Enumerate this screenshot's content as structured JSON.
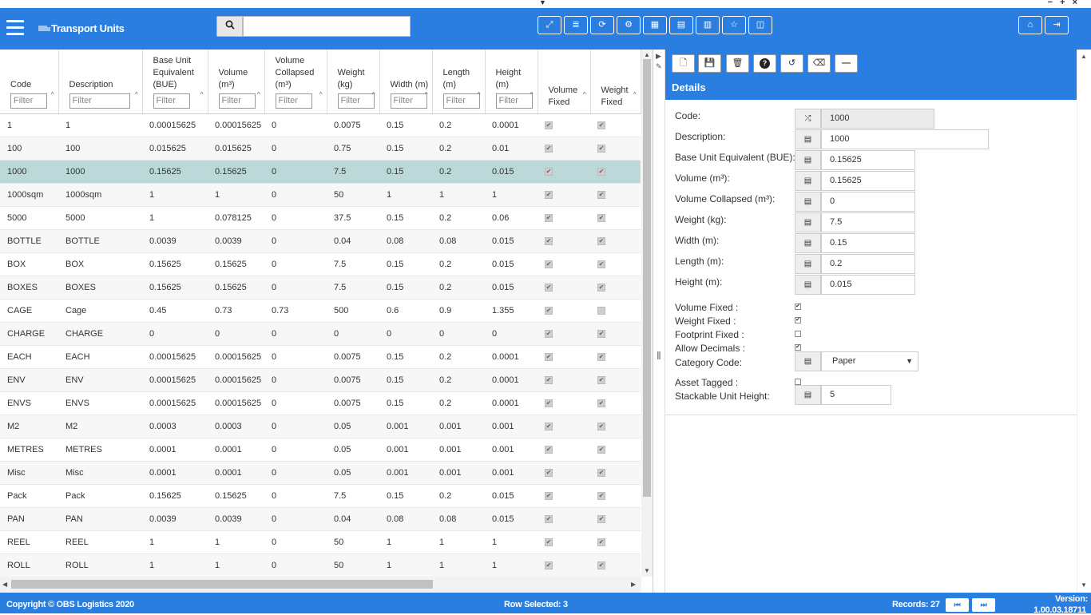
{
  "window": {
    "controls": "− + ×"
  },
  "header": {
    "title": "Transport Units",
    "search_value": ""
  },
  "grid": {
    "columns": [
      {
        "label": "Code",
        "filter": "Filter"
      },
      {
        "label": "Description",
        "filter": "Filter"
      },
      {
        "label": "Base Unit Equivalent (BUE)",
        "filter": "Filter"
      },
      {
        "label": "Volume (m³)",
        "filter": "Filter"
      },
      {
        "label": "Volume Collapsed (m³)",
        "filter": "Filter"
      },
      {
        "label": "Weight (kg)",
        "filter": "Filter"
      },
      {
        "label": "Width (m)",
        "filter": "Filter"
      },
      {
        "label": "Length (m)",
        "filter": "Filter"
      },
      {
        "label": "Height (m)",
        "filter": "Filter"
      },
      {
        "label": "Volume Fixed",
        "filter": ""
      },
      {
        "label": "Weight Fixed",
        "filter": ""
      }
    ],
    "selected_index": 2,
    "rows": [
      [
        "1",
        "1",
        "0.00015625",
        "0.00015625",
        "0",
        "0.0075",
        "0.15",
        "0.2",
        "0.0001",
        true,
        true
      ],
      [
        "100",
        "100",
        "0.015625",
        "0.015625",
        "0",
        "0.75",
        "0.15",
        "0.2",
        "0.01",
        true,
        true
      ],
      [
        "1000",
        "1000",
        "0.15625",
        "0.15625",
        "0",
        "7.5",
        "0.15",
        "0.2",
        "0.015",
        true,
        true
      ],
      [
        "1000sqm",
        "1000sqm",
        "1",
        "1",
        "0",
        "50",
        "1",
        "1",
        "1",
        true,
        true
      ],
      [
        "5000",
        "5000",
        "1",
        "0.078125",
        "0",
        "37.5",
        "0.15",
        "0.2",
        "0.06",
        true,
        true
      ],
      [
        "BOTTLE",
        "BOTTLE",
        "0.0039",
        "0.0039",
        "0",
        "0.04",
        "0.08",
        "0.08",
        "0.015",
        true,
        true
      ],
      [
        "BOX",
        "BOX",
        "0.15625",
        "0.15625",
        "0",
        "7.5",
        "0.15",
        "0.2",
        "0.015",
        true,
        true
      ],
      [
        "BOXES",
        "BOXES",
        "0.15625",
        "0.15625",
        "0",
        "7.5",
        "0.15",
        "0.2",
        "0.015",
        true,
        true
      ],
      [
        "CAGE",
        "Cage",
        "0.45",
        "0.73",
        "0.73",
        "500",
        "0.6",
        "0.9",
        "1.355",
        true,
        false
      ],
      [
        "CHARGE",
        "CHARGE",
        "0",
        "0",
        "0",
        "0",
        "0",
        "0",
        "0",
        true,
        true
      ],
      [
        "EACH",
        "EACH",
        "0.00015625",
        "0.00015625",
        "0",
        "0.0075",
        "0.15",
        "0.2",
        "0.0001",
        true,
        true
      ],
      [
        "ENV",
        "ENV",
        "0.00015625",
        "0.00015625",
        "0",
        "0.0075",
        "0.15",
        "0.2",
        "0.0001",
        true,
        true
      ],
      [
        "ENVS",
        "ENVS",
        "0.00015625",
        "0.00015625",
        "0",
        "0.0075",
        "0.15",
        "0.2",
        "0.0001",
        true,
        true
      ],
      [
        "M2",
        "M2",
        "0.0003",
        "0.0003",
        "0",
        "0.05",
        "0.001",
        "0.001",
        "0.001",
        true,
        true
      ],
      [
        "METRES",
        "METRES",
        "0.0001",
        "0.0001",
        "0",
        "0.05",
        "0.001",
        "0.001",
        "0.001",
        true,
        true
      ],
      [
        "Misc",
        "Misc",
        "0.0001",
        "0.0001",
        "0",
        "0.05",
        "0.001",
        "0.001",
        "0.001",
        true,
        true
      ],
      [
        "Pack",
        "Pack",
        "0.15625",
        "0.15625",
        "0",
        "7.5",
        "0.15",
        "0.2",
        "0.015",
        true,
        true
      ],
      [
        "PAN",
        "PAN",
        "0.0039",
        "0.0039",
        "0",
        "0.04",
        "0.08",
        "0.08",
        "0.015",
        true,
        true
      ],
      [
        "REEL",
        "REEL",
        "1",
        "1",
        "0",
        "50",
        "1",
        "1",
        "1",
        true,
        true
      ],
      [
        "ROLL",
        "ROLL",
        "1",
        "1",
        "0",
        "50",
        "1",
        "1",
        "1",
        true,
        true
      ]
    ]
  },
  "details": {
    "title": "Details",
    "fields": [
      {
        "label": "Code:",
        "value": "1000",
        "icon": "shuffle-icon",
        "readonly": true,
        "width": 142
      },
      {
        "label": "Description:",
        "value": "1000",
        "icon": "document-icon",
        "width": 210
      },
      {
        "label": "Base Unit Equivalent (BUE):",
        "value": "0.15625",
        "icon": "document-icon",
        "width": 118
      },
      {
        "label": "Volume (m³):",
        "value": "0.15625",
        "icon": "document-icon",
        "width": 118
      },
      {
        "label": "Volume Collapsed (m³):",
        "value": "0",
        "icon": "document-icon",
        "width": 118
      },
      {
        "label": "Weight (kg):",
        "value": "7.5",
        "icon": "document-icon",
        "width": 118
      },
      {
        "label": "Width (m):",
        "value": "0.15",
        "icon": "document-icon",
        "width": 118
      },
      {
        "label": "Length (m):",
        "value": "0.2",
        "icon": "document-icon",
        "width": 118
      },
      {
        "label": "Height (m):",
        "value": "0.015",
        "icon": "document-icon",
        "width": 118
      }
    ],
    "checks": [
      {
        "label": "Volume Fixed :",
        "checked": true
      },
      {
        "label": "Weight Fixed :",
        "checked": true
      },
      {
        "label": "Footprint Fixed :",
        "checked": false
      },
      {
        "label": "Allow Decimals :",
        "checked": true
      }
    ],
    "category": {
      "label": "Category Code:",
      "value": "Paper"
    },
    "asset": {
      "label": "Asset Tagged :",
      "checked": false
    },
    "stackable": {
      "label": "Stackable Unit Height:",
      "value": "5"
    }
  },
  "footer": {
    "copyright": "Copyright © OBS Logistics 2020",
    "row_selected": "Row Selected: 3",
    "records": "Records: 27",
    "version_label": "Version:",
    "version": "1.00.03.18711"
  },
  "colors": {
    "accent": "#2a7ee0",
    "selected_row": "#bcd8d8"
  }
}
